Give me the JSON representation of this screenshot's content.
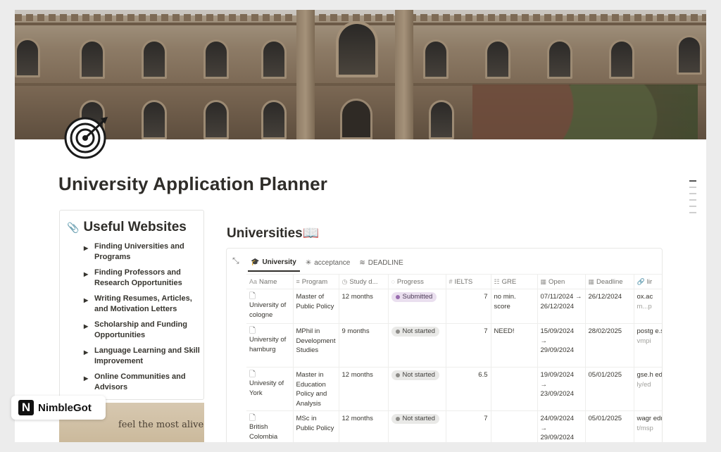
{
  "page": {
    "title": "University Application Planner",
    "icon": "target-icon"
  },
  "sidebar": {
    "heading": "Useful Websites",
    "heading_icon": "paperclip-icon",
    "items": [
      {
        "label": "Finding Universities and Programs"
      },
      {
        "label": "Finding Professors and Research Opportunities"
      },
      {
        "label": "Writing Resumes, Articles, and Motivation Letters"
      },
      {
        "label": "Scholarship and Funding Opportunities"
      },
      {
        "label": "Language Learning and Skill Improvement"
      },
      {
        "label": "Online Communities and Advisors"
      }
    ]
  },
  "photo": {
    "quote": "feel the most alive"
  },
  "brand": {
    "logo_letter": "N",
    "name": "NimbleGot"
  },
  "database": {
    "title": "Universities📖",
    "tabs": [
      {
        "label": "University",
        "icon": "🎓",
        "active": true
      },
      {
        "label": "acceptance",
        "icon": "✳",
        "active": false
      },
      {
        "label": "DEADLINE",
        "icon": "≋",
        "active": false
      }
    ],
    "columns": [
      {
        "label": "Name",
        "icon": "Aa"
      },
      {
        "label": "Program",
        "icon": "≡"
      },
      {
        "label": "Study d...",
        "icon": "◷"
      },
      {
        "label": "Progress",
        "icon": "◌"
      },
      {
        "label": "IELTS",
        "icon": "#"
      },
      {
        "label": "GRE",
        "icon": "☷"
      },
      {
        "label": "Open",
        "icon": "▦"
      },
      {
        "label": "Deadline",
        "icon": "▦"
      },
      {
        "label": "lir",
        "icon": "🔗"
      }
    ],
    "rows": [
      {
        "name": "University of cologne",
        "program": "Master of Public Policy",
        "duration": "12 months",
        "progress": "Submitted",
        "progress_key": "submitted",
        "ielts": "7",
        "gre": "no min. score",
        "open": "07/11/2024 → 26/12/2024",
        "deadline": "26/12/2024",
        "link": "ox.ac",
        "link_sub": "m...p"
      },
      {
        "name": "University of hamburg",
        "program": "MPhil in Development Studies",
        "duration": "9 months",
        "progress": "Not started",
        "progress_key": "notstarted",
        "ielts": "7",
        "gre": "NEED!",
        "open": "15/09/2024 → 29/09/2024",
        "deadline": "28/02/2025",
        "link": "postg e.stu .ac.u",
        "link_sub": "vmpi"
      },
      {
        "name": "Univesity of York",
        "program": "Master in Education Policy and Analysis",
        "duration": "12 months",
        "progress": "Not started",
        "progress_key": "notstarted",
        "ielts": "6.5",
        "gre": "",
        "open": "19/09/2024 → 23/09/2024",
        "deadline": "05/01/2025",
        "link": "gse.h edu/",
        "link_sub": "ly/ed"
      },
      {
        "name": "British Colombia University",
        "program": "MSc in Public Policy",
        "duration": "12 months",
        "progress": "Not started",
        "progress_key": "notstarted",
        "ielts": "7",
        "gre": "",
        "open": "24/09/2024 → 29/09/2024",
        "deadline": "05/01/2025",
        "link": "wagr edu/",
        "link_sub": "t/msp"
      }
    ]
  }
}
